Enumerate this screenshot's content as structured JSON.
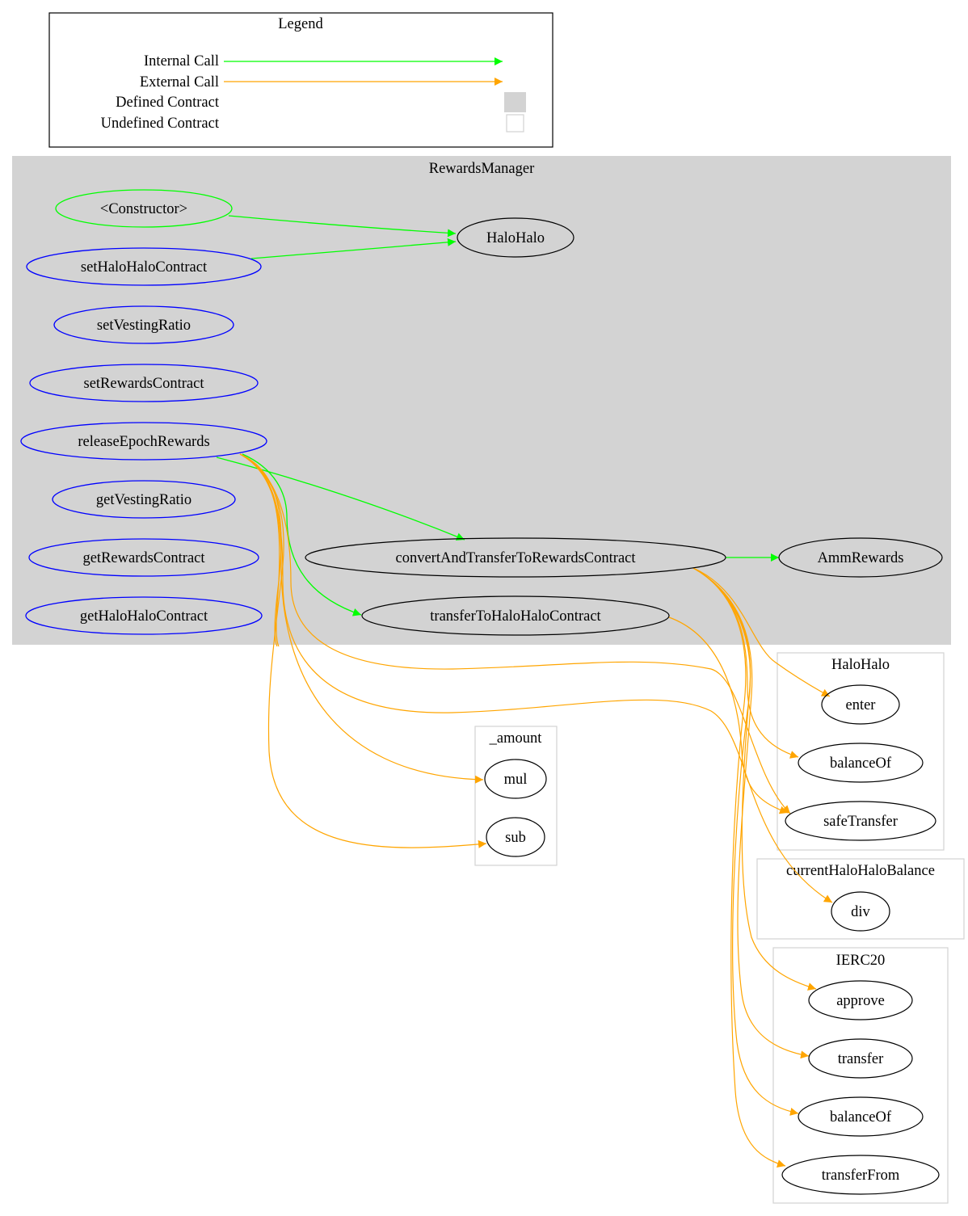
{
  "legend": {
    "title": "Legend",
    "items": [
      {
        "label": "Internal Call",
        "kind": "edge",
        "color": "#00ff00"
      },
      {
        "label": "External Call",
        "kind": "edge",
        "color": "#ffa500"
      },
      {
        "label": "Defined Contract",
        "kind": "box",
        "color": "#d3d3d3"
      },
      {
        "label": "Undefined Contract",
        "kind": "box",
        "color": "#ffffff"
      }
    ]
  },
  "colors": {
    "internal": "#00ff00",
    "external": "#ffa500",
    "defined_fill": "#d3d3d3",
    "undefined_border": "#d3d3d3",
    "public_func": "#0000ff",
    "constructor": "#00ff00",
    "node": "#000000"
  },
  "clusters": [
    {
      "id": "RewardsManager",
      "label": "RewardsManager",
      "defined": true
    },
    {
      "id": "HaloHalo",
      "label": "HaloHalo",
      "defined": false
    },
    {
      "id": "_amount",
      "label": "_amount",
      "defined": false
    },
    {
      "id": "currentHaloHaloBalance",
      "label": "currentHaloHaloBalance",
      "defined": false
    },
    {
      "id": "IERC20",
      "label": "IERC20",
      "defined": false
    }
  ],
  "nodes": [
    {
      "id": "ctor",
      "label": "<Constructor>",
      "cluster": "RewardsManager",
      "style": "constructor"
    },
    {
      "id": "setHaloHaloContract",
      "label": "setHaloHaloContract",
      "cluster": "RewardsManager",
      "style": "public"
    },
    {
      "id": "setVestingRatio",
      "label": "setVestingRatio",
      "cluster": "RewardsManager",
      "style": "public"
    },
    {
      "id": "setRewardsContract",
      "label": "setRewardsContract",
      "cluster": "RewardsManager",
      "style": "public"
    },
    {
      "id": "releaseEpochRewards",
      "label": "releaseEpochRewards",
      "cluster": "RewardsManager",
      "style": "public"
    },
    {
      "id": "getVestingRatio",
      "label": "getVestingRatio",
      "cluster": "RewardsManager",
      "style": "public"
    },
    {
      "id": "getRewardsContract",
      "label": "getRewardsContract",
      "cluster": "RewardsManager",
      "style": "public"
    },
    {
      "id": "getHaloHaloContract",
      "label": "getHaloHaloContract",
      "cluster": "RewardsManager",
      "style": "public"
    },
    {
      "id": "HaloHaloRM",
      "label": "HaloHalo",
      "cluster": "RewardsManager",
      "style": "internal"
    },
    {
      "id": "convertAndTransferToRewardsContract",
      "label": "convertAndTransferToRewardsContract",
      "cluster": "RewardsManager",
      "style": "internal"
    },
    {
      "id": "AmmRewards",
      "label": "AmmRewards",
      "cluster": "RewardsManager",
      "style": "internal"
    },
    {
      "id": "transferToHaloHaloContract",
      "label": "transferToHaloHaloContract",
      "cluster": "RewardsManager",
      "style": "internal"
    },
    {
      "id": "hh_enter",
      "label": "enter",
      "cluster": "HaloHalo",
      "style": "internal"
    },
    {
      "id": "hh_balanceOf",
      "label": "balanceOf",
      "cluster": "HaloHalo",
      "style": "internal"
    },
    {
      "id": "hh_safeTransfer",
      "label": "safeTransfer",
      "cluster": "HaloHalo",
      "style": "internal"
    },
    {
      "id": "am_mul",
      "label": "mul",
      "cluster": "_amount",
      "style": "internal"
    },
    {
      "id": "am_sub",
      "label": "sub",
      "cluster": "_amount",
      "style": "internal"
    },
    {
      "id": "chb_div",
      "label": "div",
      "cluster": "currentHaloHaloBalance",
      "style": "internal"
    },
    {
      "id": "e_approve",
      "label": "approve",
      "cluster": "IERC20",
      "style": "internal"
    },
    {
      "id": "e_transfer",
      "label": "transfer",
      "cluster": "IERC20",
      "style": "internal"
    },
    {
      "id": "e_balanceOf",
      "label": "balanceOf",
      "cluster": "IERC20",
      "style": "internal"
    },
    {
      "id": "e_transferFrom",
      "label": "transferFrom",
      "cluster": "IERC20",
      "style": "internal"
    }
  ],
  "edges": [
    {
      "from": "ctor",
      "to": "HaloHaloRM",
      "type": "internal"
    },
    {
      "from": "setHaloHaloContract",
      "to": "HaloHaloRM",
      "type": "internal"
    },
    {
      "from": "releaseEpochRewards",
      "to": "convertAndTransferToRewardsContract",
      "type": "internal"
    },
    {
      "from": "releaseEpochRewards",
      "to": "transferToHaloHaloContract",
      "type": "internal"
    },
    {
      "from": "convertAndTransferToRewardsContract",
      "to": "AmmRewards",
      "type": "internal"
    },
    {
      "from": "releaseEpochRewards",
      "to": "am_mul",
      "type": "external"
    },
    {
      "from": "releaseEpochRewards",
      "to": "am_sub",
      "type": "external"
    },
    {
      "from": "releaseEpochRewards",
      "to": "hh_safeTransfer",
      "type": "external"
    },
    {
      "from": "releaseEpochRewards",
      "to": "chb_div",
      "type": "external"
    },
    {
      "from": "releaseEpochRewards",
      "to": "e_transferFrom",
      "type": "external"
    },
    {
      "from": "releaseEpochRewards",
      "to": "hh_balanceOf",
      "type": "external"
    },
    {
      "from": "convertAndTransferToRewardsContract",
      "to": "hh_enter",
      "type": "external"
    },
    {
      "from": "convertAndTransferToRewardsContract",
      "to": "e_approve",
      "type": "external"
    },
    {
      "from": "convertAndTransferToRewardsContract",
      "to": "e_transfer",
      "type": "external"
    },
    {
      "from": "convertAndTransferToRewardsContract",
      "to": "e_balanceOf",
      "type": "external"
    },
    {
      "from": "transferToHaloHaloContract",
      "to": "hh_safeTransfer",
      "type": "external"
    }
  ]
}
